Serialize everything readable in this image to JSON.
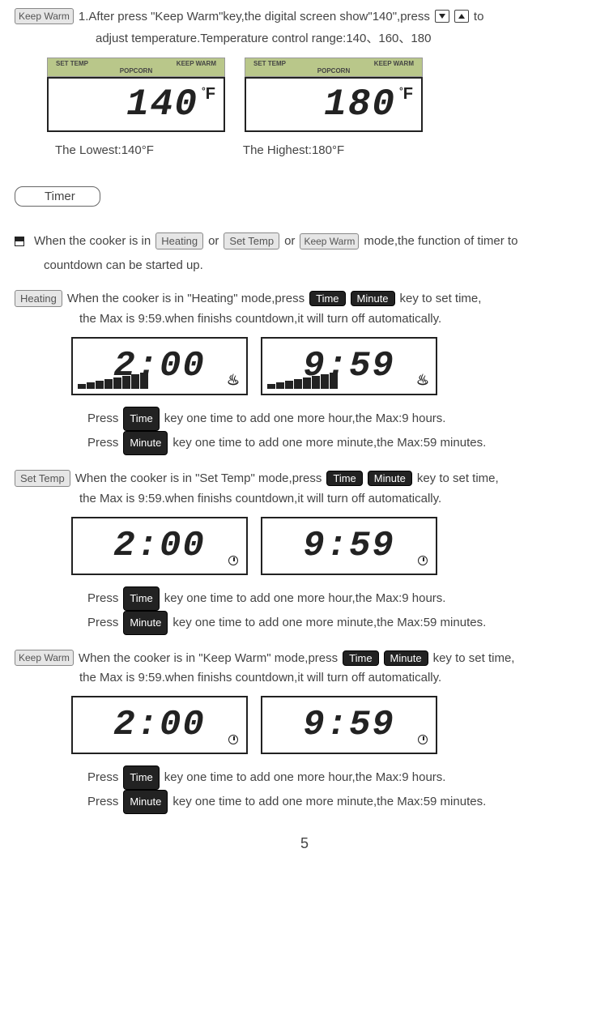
{
  "top": {
    "keepwarm_key": "Keep Warm",
    "line1_a": "1.After press \"Keep Warm\"key,the digital screen show\"140\",press",
    "line1_b": "to",
    "line2": "adjust temperature.Temperature control range:140、160、180"
  },
  "lcd": {
    "set_temp": "SET TEMP",
    "keep_warm": "KEEP WARM",
    "popcorn": "POPCORN",
    "val_low": "140",
    "val_high": "180",
    "degF": "F",
    "caption_low": "The Lowest:140°F",
    "caption_high": "The Highest:180°F"
  },
  "timer": {
    "label": "Timer",
    "intro_a": "When the cooker is in",
    "intro_or": "or",
    "intro_b": "mode,the function of timer to",
    "intro_c": "countdown can be started up.",
    "heating_key": "Heating",
    "settemp_key": "Set Temp",
    "keepwarm_key": "Keep Warm",
    "time_key": "Time",
    "minute_key": "Minute",
    "heating_line1_a": "When the cooker is in \"Heating\" mode,press",
    "heating_line1_b": "key to set time,",
    "settemp_line1_a": "When the cooker is in \"Set Temp\" mode,press",
    "keepwarm_line1_a": "When the cooker is in \"Keep Warm\" mode,press",
    "line2_common": "the Max is 9:59.when finishs countdown,it will turn off automatically.",
    "disp_200": "2:00",
    "disp_959": "9:59",
    "press_prefix": "Press",
    "press_time_suffix": "key one time to add one more hour,the Max:9 hours.",
    "press_minute_suffix": "key one time to add one more minute,the Max:59 minutes."
  },
  "page_number": "5"
}
